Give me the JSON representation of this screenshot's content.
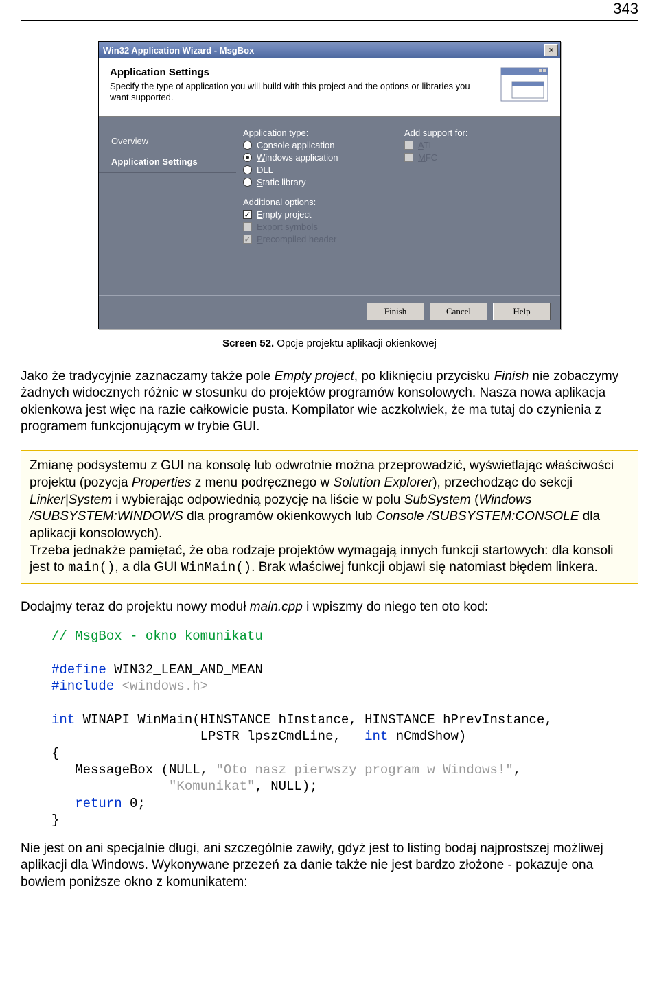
{
  "page_number": "343",
  "wizard": {
    "title": "Win32 Application Wizard - MsgBox",
    "close_glyph": "×",
    "banner_title": "Application Settings",
    "banner_desc": "Specify the type of application you will build with this project and the options or libraries you want supported.",
    "sidebar": {
      "overview": "Overview",
      "appsettings": "Application Settings"
    },
    "app_type_label": "Application type:",
    "opts": {
      "console_pre": "C",
      "console_u": "o",
      "console_post": "nsole application",
      "windows_u": "W",
      "windows_post": "indows application",
      "dll_u": "D",
      "dll_post": "LL",
      "static_u": "S",
      "static_post": "tatic library"
    },
    "addl_label": "Additional options:",
    "addl": {
      "empty_u": "E",
      "empty_post": "mpty project",
      "export_pre": "E",
      "export_u": "x",
      "export_post": "port symbols",
      "precomp_u": "P",
      "precomp_post": "recompiled header"
    },
    "support_label": "Add support for:",
    "support": {
      "atl_u": "A",
      "atl_post": "TL",
      "mfc_u": "M",
      "mfc_post": "FC"
    },
    "buttons": {
      "finish": "Finish",
      "cancel": "Cancel",
      "help": "Help"
    }
  },
  "caption_bold": "Screen 52.",
  "caption_rest": " Opcje projektu aplikacji okienkowej",
  "para1": {
    "t1": "Jako że tradycyjnie zaznaczamy także pole ",
    "em1": "Empty project",
    "t2": ", po kliknięciu przycisku ",
    "em2": "Finish",
    "t3": " nie zobaczymy żadnych widocznych różnic w stosunku do projektów programów konsolowych. Nasza nowa aplikacja okienkowa jest więc na razie całkowicie pusta. Kompilator wie aczkolwiek, że ma tutaj do czynienia z programem funkcjonującym w trybie GUI."
  },
  "tip": {
    "t1": "Zmianę podsystemu z GUI na konsolę lub odwrotnie można przeprowadzić, wyświetlając właściwości projektu (pozycja ",
    "em1": "Properties",
    "t2": " z menu podręcznego w ",
    "em2": "Solution Explorer",
    "t3": "), przechodząc do sekcji ",
    "em3": "Linker|System",
    "t4": " i wybierając odpowiednią pozycję na liście w polu ",
    "em4": "SubSystem",
    "t5": " (",
    "em5": "Windows /SUBSYSTEM:WINDOWS",
    "t6": " dla programów okienkowych lub ",
    "em6": "Console /SUBSYSTEM:CONSOLE",
    "t7": " dla aplikacji konsolowych).",
    "br": "Trzeba jednakże pamiętać, że oba rodzaje projektów wymagają innych funkcji startowych: dla konsoli jest to ",
    "code1": "main()",
    "t8": ", a dla GUI ",
    "code2": "WinMain()",
    "t9": ". Brak właściwej funkcji objawi się natomiast błędem linkera."
  },
  "para2": {
    "t1": "Dodajmy teraz do projektu nowy moduł ",
    "em1": "main.cpp",
    "t2": " i wpiszmy do niego ten oto kod:"
  },
  "code": {
    "comment": "// MsgBox - okno komunikatu",
    "define": "#define",
    "define_rest": " WIN32_LEAN_AND_MEAN",
    "include": "#include",
    "include_rest": " <windows.h>",
    "int": "int",
    "sig1": " WINAPI WinMain(HINSTANCE hInstance, HINSTANCE hPrevInstance,",
    "sig2": "                   LPSTR lpszCmdLine,   ",
    "int2": "int",
    "sig2b": " nCmdShow)",
    "brace_o": "{",
    "mb_pre": "   MessageBox (NULL, ",
    "mb_s1": "\"Oto nasz pierwszy program w Windows!\"",
    "mb_mid": ",",
    "mb_line2a": "               ",
    "mb_s2": "\"Komunikat\"",
    "mb_post": ", NULL);",
    "ret": "   return",
    "ret_rest": " 0;",
    "brace_c": "}"
  },
  "para3": "Nie jest on ani specjalnie długi, ani szczególnie zawiły, gdyż jest to listing bodaj najprostszej możliwej aplikacji dla Windows. Wykonywane przezeń za danie także nie jest bardzo złożone - pokazuje ona bowiem poniższe okno z komunikatem:"
}
